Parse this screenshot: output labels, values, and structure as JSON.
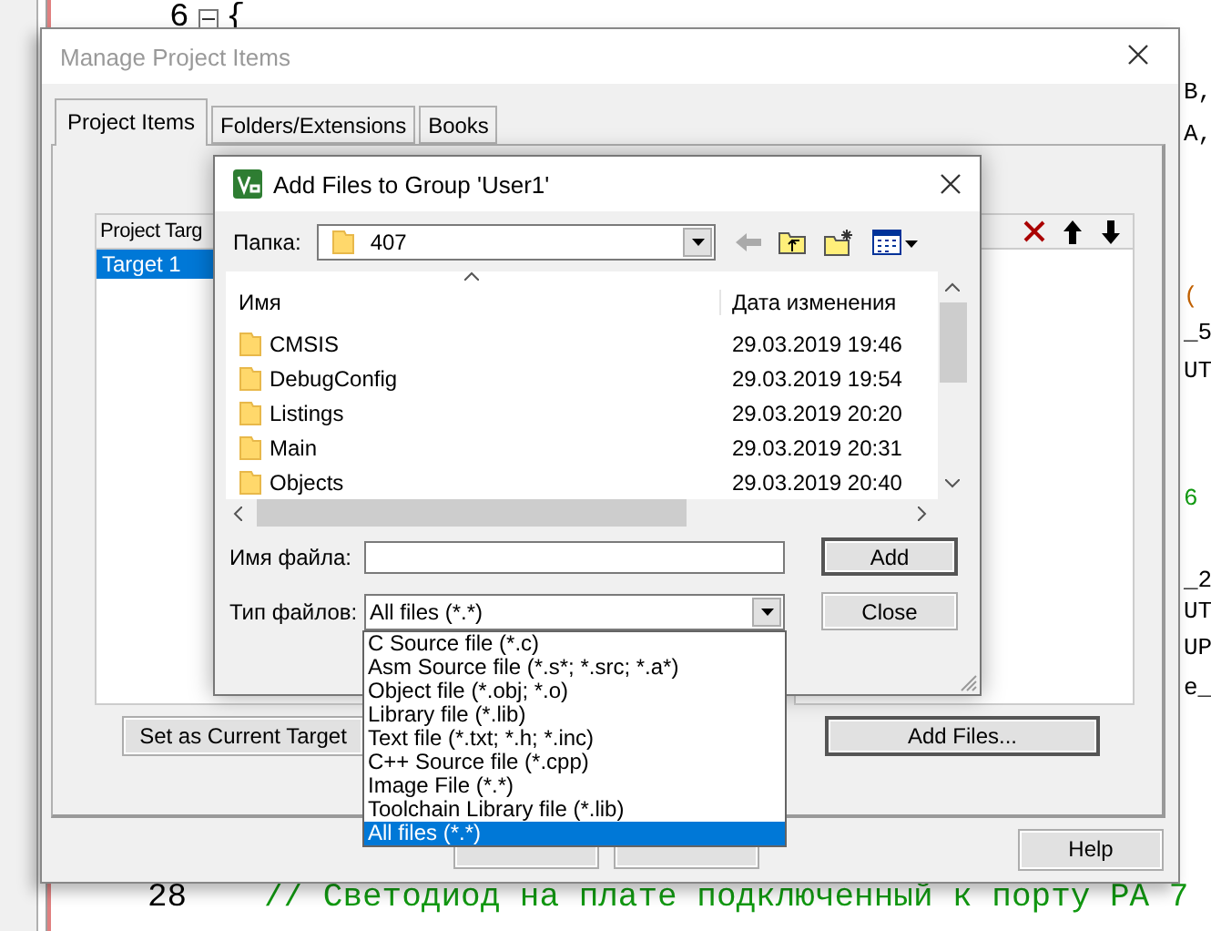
{
  "editor": {
    "top_line": {
      "number": "6",
      "code": "{",
      "folded": false
    },
    "bottom_line": {
      "number": "28",
      "code": "// Светодиод на плате подключенный к порту PA 7",
      "kind": "comment"
    },
    "fragments": [
      {
        "text": "B,",
        "kind": "code"
      },
      {
        "text": "A,",
        "kind": "code"
      },
      {
        "text": "(",
        "kind": "number"
      },
      {
        "text": "_5",
        "kind": "code"
      },
      {
        "text": "UT",
        "kind": "code"
      },
      {
        "text": "6",
        "kind": "comment"
      },
      {
        "text": "_2",
        "kind": "code"
      },
      {
        "text": "UT",
        "kind": "code"
      },
      {
        "text": "UP",
        "kind": "code"
      },
      {
        "text": "e_",
        "kind": "code"
      }
    ]
  },
  "manage_window": {
    "title": "Manage Project Items",
    "active": false,
    "tabs": [
      {
        "label": "Project Items",
        "selected": true
      },
      {
        "label": "Folders/Extensions",
        "selected": false
      },
      {
        "label": "Books",
        "selected": false
      }
    ],
    "targets": {
      "header": "Project Targ",
      "items": [
        {
          "label": "Target 1",
          "selected": true
        }
      ]
    },
    "set_current_button": "Set as Current Target",
    "add_files_button": "Add Files...",
    "help_button": "Help"
  },
  "dialog": {
    "title": "Add Files to Group 'User1'",
    "folder_label": "Папка:",
    "folder": "407",
    "columns": [
      "Имя",
      "Дата изменения"
    ],
    "rows": [
      {
        "name": "CMSIS",
        "modified": "29.03.2019 19:46"
      },
      {
        "name": "DebugConfig",
        "modified": "29.03.2019 19:54"
      },
      {
        "name": "Listings",
        "modified": "29.03.2019 20:20"
      },
      {
        "name": "Main",
        "modified": "29.03.2019 20:31"
      },
      {
        "name": "Objects",
        "modified": "29.03.2019 20:40"
      }
    ],
    "filename_label": "Имя файла:",
    "type_label": "Тип файлов:",
    "type_value": "All files (*.*)",
    "add_button": "Add",
    "close_button": "Close",
    "type_options": [
      {
        "label": "C Source file (*.c)",
        "selected": false
      },
      {
        "label": "Asm Source file (*.s*; *.src; *.a*)",
        "selected": false
      },
      {
        "label": "Object file (*.obj; *.o)",
        "selected": false
      },
      {
        "label": "Library file (*.lib)",
        "selected": false
      },
      {
        "label": "Text file (*.txt; *.h; *.inc)",
        "selected": false
      },
      {
        "label": "C++ Source file (*.cpp)",
        "selected": false
      },
      {
        "label": "Image File (*.*)",
        "selected": false
      },
      {
        "label": "Toolchain Library file (*.lib)",
        "selected": false
      },
      {
        "label": "All files (*.*)",
        "selected": true
      }
    ]
  }
}
